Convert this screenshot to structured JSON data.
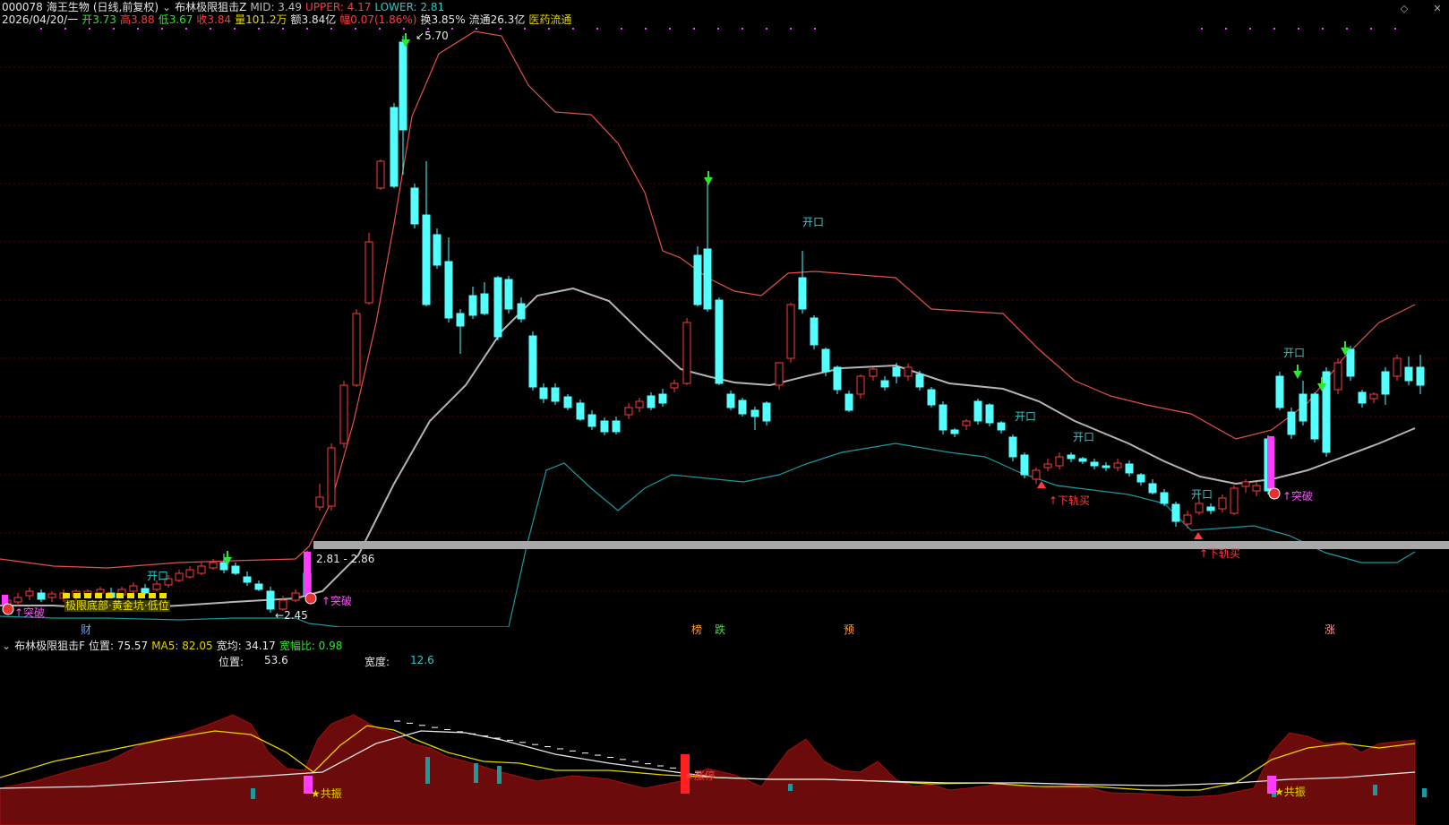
{
  "header": {
    "code": "000078",
    "name": "海王生物",
    "mode": "(日线,前复权)",
    "indicator_name": "布林极限狙击Z",
    "mid": "MID: 3.49",
    "upper": "UPPER: 4.17",
    "lower": "LOWER: 2.81",
    "date": "2026/04/20/一",
    "open": "开3.73",
    "high": "高3.88",
    "low": "低3.67",
    "close": "收3.84",
    "volume": "量101.2万",
    "amount": "额3.84亿",
    "change": "幅0.07(1.86%)",
    "turnover": "换3.85%",
    "float": "流通26.3亿",
    "sector": "医药流通"
  },
  "sub_header": {
    "indicator_name": "布林极限狙击F",
    "position": "位置: 75.57",
    "ma5": "MA5: 82.05",
    "width": "宽均: 34.17",
    "width_ratio": "宽幅比: 0.98",
    "pos_label": "位置:",
    "pos_value": "53.6",
    "width_label": "宽度:",
    "width_value": "12.6"
  },
  "annotations": {
    "high_label": "5.70",
    "low_label": "2.45",
    "range_label": "2.81 - 2.86",
    "kaikou": "开口",
    "breakout": "↑突破",
    "lower_rail": "↑下轨买",
    "resonance": "★共振",
    "limit_up": "★涨停",
    "bottom_label": "极限底部·黄金坑·低位",
    "event_cai": "财",
    "event_bang": "榜",
    "event_die": "跌",
    "event_yu": "预",
    "event_zhang": "涨"
  },
  "colors": {
    "up": "#ff3b3b",
    "down": "#54ffff",
    "upper": "#e6504a",
    "mid": "#b4b4b4",
    "lower": "#1b9aa0",
    "magenta": "#ff3cff",
    "band_fill": "#6b0b0b"
  },
  "icons": {
    "collapse": "chevron-down-icon",
    "close": "close-icon",
    "expand": "diamond-icon"
  }
}
